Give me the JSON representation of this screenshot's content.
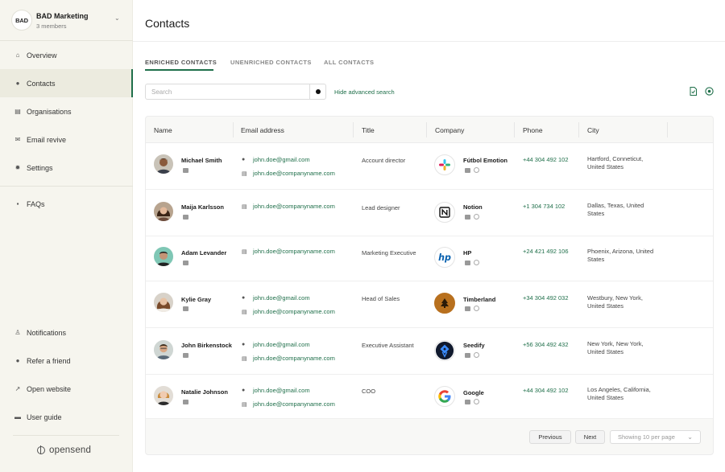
{
  "workspace": {
    "logo": "BAD",
    "name": "BAD Marketing",
    "members": "3 members"
  },
  "nav": {
    "main": [
      {
        "label": "Overview",
        "icon": "home-icon"
      },
      {
        "label": "Contacts",
        "icon": "person-icon",
        "active": true
      },
      {
        "label": "Organisations",
        "icon": "building-icon"
      },
      {
        "label": "Email revive",
        "icon": "mail-icon"
      },
      {
        "label": "Settings",
        "icon": "gear-icon"
      }
    ],
    "faqs": {
      "label": "FAQs",
      "icon": "help-icon"
    },
    "bottom": [
      {
        "label": "Notifications",
        "icon": "bell-icon"
      },
      {
        "label": "Refer a friend",
        "icon": "user-plus-icon"
      },
      {
        "label": "Open website",
        "icon": "external-link-icon"
      },
      {
        "label": "User guide",
        "icon": "folder-icon"
      }
    ],
    "brand": "opensend"
  },
  "page": {
    "title": "Contacts"
  },
  "tabs": [
    "ENRICHED CONTACTS",
    "UNENRICHED CONTACTS",
    "ALL CONTACTS"
  ],
  "search": {
    "placeholder": "Search",
    "advanced": "Hide advanced search"
  },
  "table": {
    "columns": [
      "Name",
      "Email address",
      "Title",
      "Company",
      "Phone",
      "City"
    ],
    "rows": [
      {
        "name": "Michael Smith",
        "emails": [
          "john.doe@gmail.com",
          "john.doe@companyname.com"
        ],
        "title": "Account director",
        "company": "Fútbol Emotion",
        "logo": "slack-logo",
        "phone": "+44 304 492 102",
        "city": [
          "Hartford, Conneticut,",
          "United States"
        ]
      },
      {
        "name": "Maija Karlsson",
        "emails": [
          "john.doe@companyname.com"
        ],
        "title": "Lead designer",
        "company": "Notion",
        "logo": "notion-logo",
        "phone": "+1 304 734 102",
        "city": [
          "Dallas, Texas, United",
          "States"
        ]
      },
      {
        "name": "Adam Levander",
        "emails": [
          "john.doe@companyname.com"
        ],
        "title": "Marketing Executive",
        "company": "HP",
        "logo": "hp-logo",
        "phone": "+24 421 492 106",
        "city": [
          "Phoenix, Arizona, United",
          "States"
        ]
      },
      {
        "name": "Kylie Gray",
        "emails": [
          "john.doe@gmail.com",
          "john.doe@companyname.com"
        ],
        "title": "Head of Sales",
        "company": "Timberland",
        "logo": "timberland-logo",
        "phone": "+34 304 492 032",
        "city": [
          "Westbury, New York,",
          "United States"
        ]
      },
      {
        "name": "John Birkenstock",
        "emails": [
          "john.doe@gmail.com",
          "john.doe@companyname.com"
        ],
        "title": "Executive Assistant",
        "company": "Seedify",
        "logo": "seedify-logo",
        "phone": "+56 304 492 432",
        "city": [
          "New York, New York,",
          "United States"
        ]
      },
      {
        "name": "Natalie Johnson",
        "emails": [
          "john.doe@gmail.com",
          "john.doe@companyname.com"
        ],
        "title": "COO",
        "company": "Google",
        "logo": "google-logo",
        "phone": "+44 304 492 102",
        "city": [
          "Los Angeles, California,",
          "United States"
        ]
      }
    ]
  },
  "pagination": {
    "previous": "Previous",
    "next": "Next",
    "per_page": "Showing 10 per page"
  },
  "colors": {
    "accent": "#1f6f4a",
    "sidebar_bg": "#f6f5ee"
  }
}
